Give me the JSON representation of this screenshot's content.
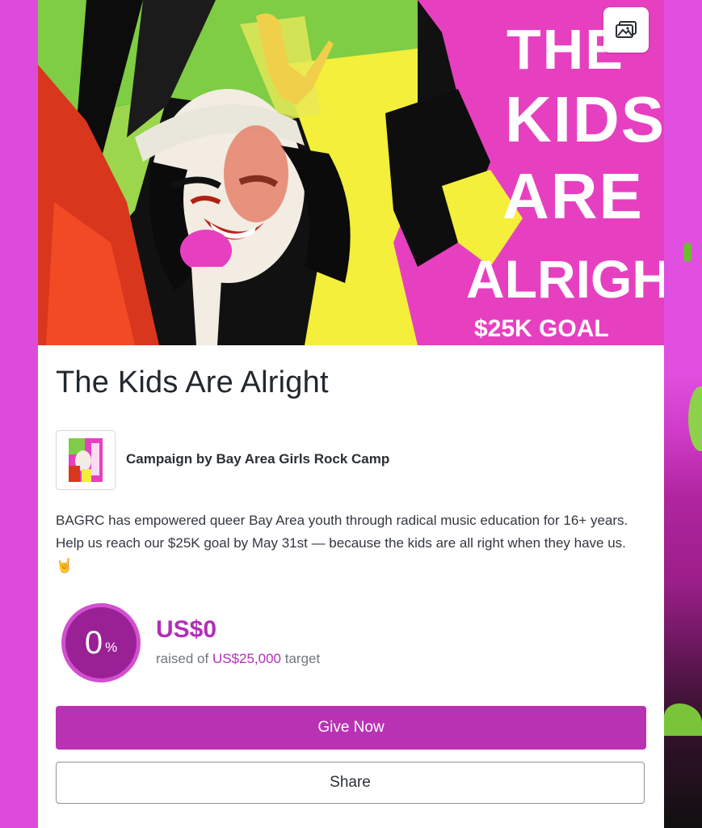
{
  "campaign": {
    "title": "The Kids Are Alright",
    "organizer_label": "Campaign by Bay Area Girls Rock Camp",
    "description": "BAGRC has empowered queer Bay Area youth through radical music education for 16+ years. Help us reach our $25K goal by May 31st — because the kids are all right when they have us.",
    "description_emoji": "🤘",
    "hero_art_text": [
      "THE",
      "KIDS",
      "ARE",
      "ALRIGHT"
    ],
    "hero_goal_text": "$25K GOAL"
  },
  "progress": {
    "percent_value": "0",
    "percent_symbol": "%",
    "raised_amount": "US$0",
    "raised_prefix": "raised of",
    "target_amount": "US$25,000",
    "target_suffix": "target",
    "fraction": 0
  },
  "actions": {
    "give_label": "Give Now",
    "share_label": "Share"
  },
  "icons": {
    "gallery": "image-gallery-icon"
  },
  "colors": {
    "accent": "#b932b4",
    "accent_text": "#b22fb7",
    "page_bg": "#dc4bdc",
    "ring_border": "#d24fd0"
  }
}
